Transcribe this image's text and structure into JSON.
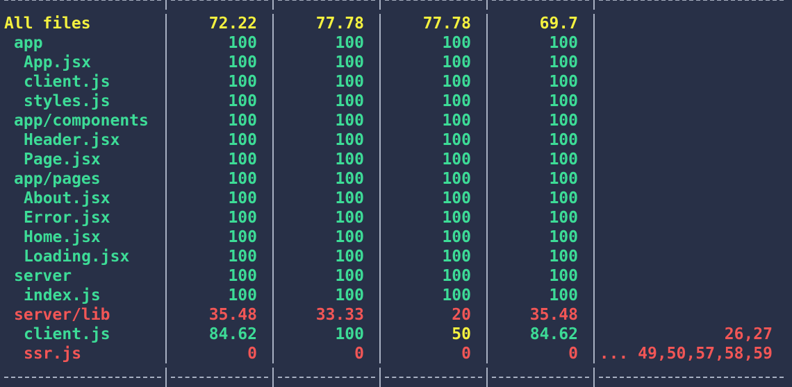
{
  "rows": [
    {
      "file": "All files",
      "indent": 0,
      "color": "yellow",
      "v": [
        "72.22",
        "77.78",
        "77.78",
        "69.7",
        ""
      ],
      "vc": [
        "yellow",
        "yellow",
        "yellow",
        "yellow",
        ""
      ]
    },
    {
      "file": "app",
      "indent": 1,
      "color": "green",
      "v": [
        "100",
        "100",
        "100",
        "100",
        ""
      ],
      "vc": [
        "green",
        "green",
        "green",
        "green",
        ""
      ]
    },
    {
      "file": "App.jsx",
      "indent": 2,
      "color": "green",
      "v": [
        "100",
        "100",
        "100",
        "100",
        ""
      ],
      "vc": [
        "green",
        "green",
        "green",
        "green",
        ""
      ]
    },
    {
      "file": "client.js",
      "indent": 2,
      "color": "green",
      "v": [
        "100",
        "100",
        "100",
        "100",
        ""
      ],
      "vc": [
        "green",
        "green",
        "green",
        "green",
        ""
      ]
    },
    {
      "file": "styles.js",
      "indent": 2,
      "color": "green",
      "v": [
        "100",
        "100",
        "100",
        "100",
        ""
      ],
      "vc": [
        "green",
        "green",
        "green",
        "green",
        ""
      ]
    },
    {
      "file": "app/components",
      "indent": 1,
      "color": "green",
      "v": [
        "100",
        "100",
        "100",
        "100",
        ""
      ],
      "vc": [
        "green",
        "green",
        "green",
        "green",
        ""
      ]
    },
    {
      "file": "Header.jsx",
      "indent": 2,
      "color": "green",
      "v": [
        "100",
        "100",
        "100",
        "100",
        ""
      ],
      "vc": [
        "green",
        "green",
        "green",
        "green",
        ""
      ]
    },
    {
      "file": "Page.jsx",
      "indent": 2,
      "color": "green",
      "v": [
        "100",
        "100",
        "100",
        "100",
        ""
      ],
      "vc": [
        "green",
        "green",
        "green",
        "green",
        ""
      ]
    },
    {
      "file": "app/pages",
      "indent": 1,
      "color": "green",
      "v": [
        "100",
        "100",
        "100",
        "100",
        ""
      ],
      "vc": [
        "green",
        "green",
        "green",
        "green",
        ""
      ]
    },
    {
      "file": "About.jsx",
      "indent": 2,
      "color": "green",
      "v": [
        "100",
        "100",
        "100",
        "100",
        ""
      ],
      "vc": [
        "green",
        "green",
        "green",
        "green",
        ""
      ]
    },
    {
      "file": "Error.jsx",
      "indent": 2,
      "color": "green",
      "v": [
        "100",
        "100",
        "100",
        "100",
        ""
      ],
      "vc": [
        "green",
        "green",
        "green",
        "green",
        ""
      ]
    },
    {
      "file": "Home.jsx",
      "indent": 2,
      "color": "green",
      "v": [
        "100",
        "100",
        "100",
        "100",
        ""
      ],
      "vc": [
        "green",
        "green",
        "green",
        "green",
        ""
      ]
    },
    {
      "file": "Loading.jsx",
      "indent": 2,
      "color": "green",
      "v": [
        "100",
        "100",
        "100",
        "100",
        ""
      ],
      "vc": [
        "green",
        "green",
        "green",
        "green",
        ""
      ]
    },
    {
      "file": "server",
      "indent": 1,
      "color": "green",
      "v": [
        "100",
        "100",
        "100",
        "100",
        ""
      ],
      "vc": [
        "green",
        "green",
        "green",
        "green",
        ""
      ]
    },
    {
      "file": "index.js",
      "indent": 2,
      "color": "green",
      "v": [
        "100",
        "100",
        "100",
        "100",
        ""
      ],
      "vc": [
        "green",
        "green",
        "green",
        "green",
        ""
      ]
    },
    {
      "file": "server/lib",
      "indent": 1,
      "color": "red",
      "v": [
        "35.48",
        "33.33",
        "20",
        "35.48",
        ""
      ],
      "vc": [
        "red",
        "red",
        "red",
        "red",
        ""
      ]
    },
    {
      "file": "client.js",
      "indent": 2,
      "color": "green",
      "v": [
        "84.62",
        "100",
        "50",
        "84.62",
        "26,27"
      ],
      "vc": [
        "green",
        "green",
        "yellow",
        "green",
        "red"
      ]
    },
    {
      "file": "ssr.js",
      "indent": 2,
      "color": "red",
      "v": [
        "0",
        "0",
        "0",
        "0",
        "... 49,50,57,58,59"
      ],
      "vc": [
        "red",
        "red",
        "red",
        "red",
        "red"
      ]
    }
  ],
  "colors": {
    "background": "#283047",
    "green": "#3ddc97",
    "yellow": "#f4f13f",
    "red": "#f25656",
    "border": "#a8b0c2"
  }
}
